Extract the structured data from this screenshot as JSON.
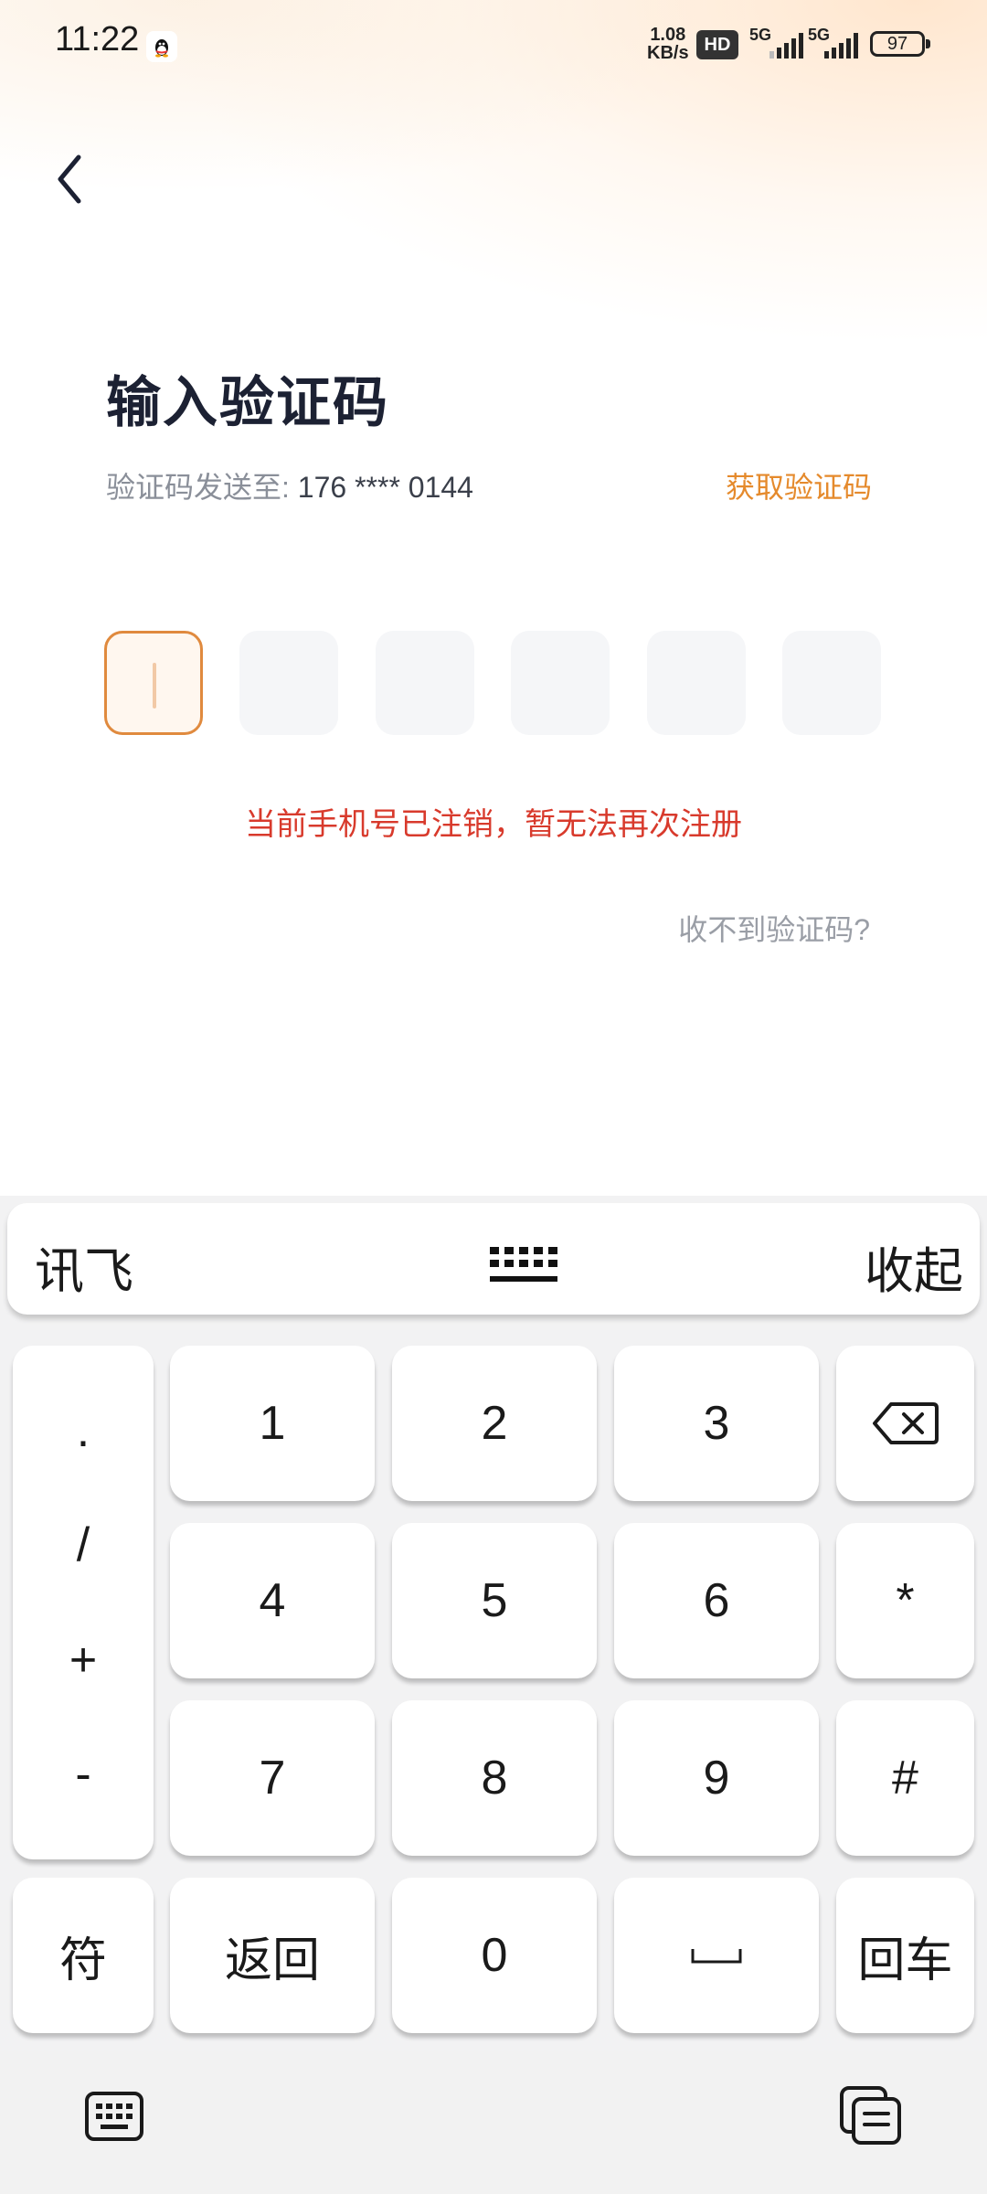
{
  "status_bar": {
    "time": "11:22",
    "net_speed_value": "1.08",
    "net_speed_unit": "KB/s",
    "hd_badge": "HD",
    "signal1_label": "5G",
    "signal2_label": "5G",
    "battery": "97"
  },
  "header": {
    "title": "输入验证码",
    "sent_to_label": "验证码发送至: ",
    "phone_masked": "176 **** 0144",
    "get_code_label": "获取验证码"
  },
  "code_input": {
    "length": 6,
    "values": [
      "",
      "",
      "",
      "",
      "",
      ""
    ],
    "active_index": 0
  },
  "error_message": "当前手机号已注销，暂无法再次注册",
  "no_code_link": "收不到验证码?",
  "keyboard": {
    "ime_name": "讯飞",
    "collapse_label": "收起",
    "symbols": [
      ".",
      "/",
      "+",
      "-"
    ],
    "digits": [
      "1",
      "2",
      "3",
      "4",
      "5",
      "6",
      "7",
      "8",
      "9"
    ],
    "star": "*",
    "hash": "#",
    "symbol_key": "符",
    "back_key": "返回",
    "zero": "0",
    "space_key": "␣",
    "enter_key": "回车"
  },
  "colors": {
    "accent": "#e58a2c",
    "error": "#d83a2c",
    "title": "#1c2133"
  }
}
